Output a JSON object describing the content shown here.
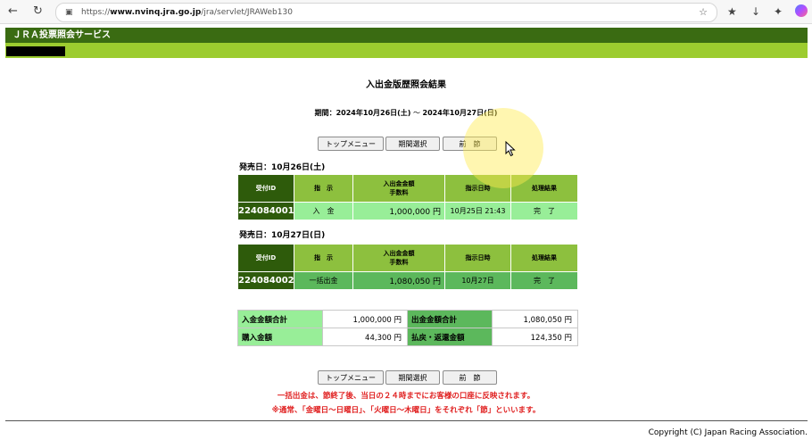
{
  "browser": {
    "url_prefix": "https://",
    "url_domain": "www.nvinq.jra.go.jp",
    "url_path": "/jra/servlet/JRAWeb130",
    "icons": [
      "back-icon",
      "refresh-icon",
      "lock-icon",
      "star-icon",
      "favorites-icon",
      "download-icon",
      "extensions-icon"
    ]
  },
  "header": {
    "title": "ＪＲＡ投票照会サービス"
  },
  "page": {
    "title": "入出金版歴照会結果",
    "period_label": "期間：",
    "period_start": "2024年10月26日(土)",
    "period_sep": " ～ ",
    "period_end": "2024年10月27日(日)"
  },
  "buttons": {
    "top_menu": "トップメニュー",
    "period_select": "期間選択",
    "previous": "前　節"
  },
  "day1": {
    "date_label": "発売日：10月26日(土)",
    "headers": {
      "id": "受付ID",
      "instruction": "指　示",
      "amount_line1": "入出金金額",
      "amount_line2": "手数料",
      "datetime": "指示日時",
      "result": "処理結果"
    },
    "row": {
      "id": "224084001",
      "instruction": "入　金",
      "amount": "1,000,000 円",
      "datetime": "10月25日 21:43",
      "result": "完　了"
    }
  },
  "day2": {
    "date_label": "発売日：10月27日(日)",
    "headers": {
      "id": "受付ID",
      "instruction": "指　示",
      "amount_line1": "入出金金額",
      "amount_line2": "手数料",
      "datetime": "指示日時",
      "result": "処理結果"
    },
    "row": {
      "id": "224084002",
      "instruction": "一括出金",
      "amount": "1,080,050 円",
      "datetime": "10月27日",
      "result": "完　了"
    }
  },
  "summary": {
    "deposit_total_label": "入金金額合計",
    "deposit_total_value": "1,000,000 円",
    "withdrawal_total_label": "出金金額合計",
    "withdrawal_total_value": "1,080,050 円",
    "purchase_label": "購入金額",
    "purchase_value": "44,300 円",
    "refund_label": "払戻・返還金額",
    "refund_value": "124,350 円"
  },
  "notes": {
    "line1": "一括出金は、節終了後、当日の２４時までにお客様の口座に反映されます。",
    "line2": "※通常、「金曜日～日曜日」、「火曜日～木曜日」をそれぞれ「節」といいます。"
  },
  "footer": {
    "copyright": "Copyright (C) Japan Racing Association."
  },
  "colors": {
    "header_dark": "#3a6b12",
    "header_light": "#9ccc2f",
    "cell_light_green": "#98ee98",
    "cell_mid_green": "#5cb85c",
    "id_dark_green": "#2e5b0b",
    "note_red": "#e02020"
  }
}
